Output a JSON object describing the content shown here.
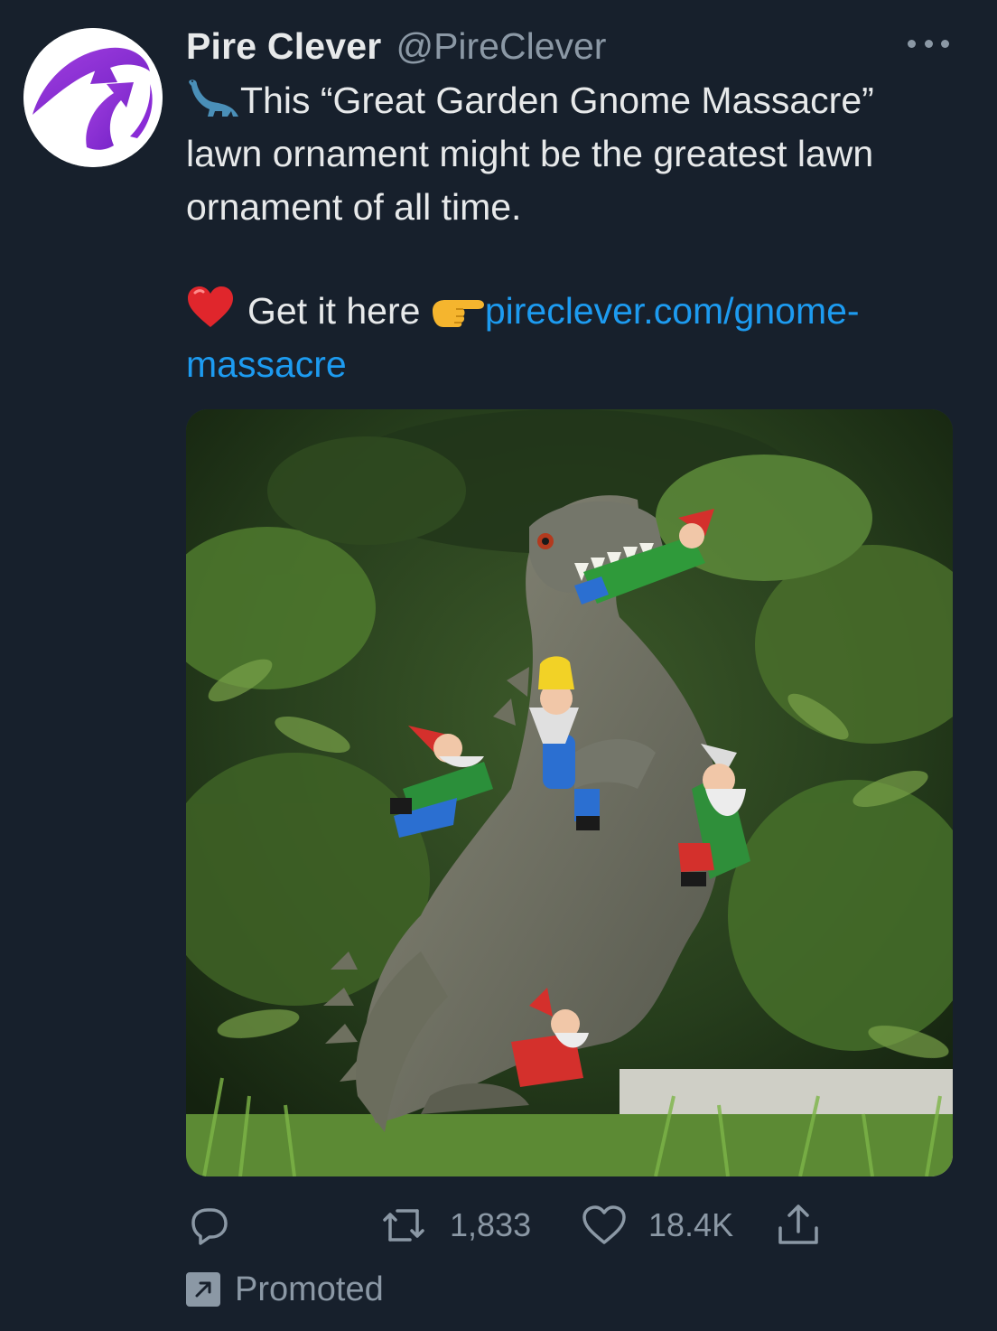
{
  "account": {
    "display_name": "Pire Clever",
    "handle": "@PireClever"
  },
  "icons": {
    "avatar": "curved-arrow-logo",
    "dinosaur": "sauropod-emoji",
    "heart": "red-heart-emoji",
    "pointer": "backhand-index-pointing-right-emoji",
    "reply": "speech-bubble-icon",
    "retweet": "retweet-icon",
    "like": "heart-outline-icon",
    "share": "share-upload-icon",
    "more": "more-dots-icon",
    "promoted": "promoted-arrow-icon"
  },
  "tweet": {
    "line1": "This “Great Garden Gnome Massacre”",
    "line2": "lawn ornament might be the greatest lawn",
    "line3": "ornament of all time.",
    "cta": "Get it here ",
    "link_part1": "pireclever.com/gnome-",
    "link_part2": "massacre"
  },
  "media": {
    "subject": "dinosaur statue eating garden gnomes"
  },
  "actions": {
    "retweets": "1,833",
    "likes": "18.4K"
  },
  "footer": {
    "promoted_label": "Promoted"
  },
  "colors": {
    "background": "#17202c",
    "link": "#1d9bf0",
    "muted": "#8b98a5",
    "avatar_purple": "#8a2bd6"
  }
}
